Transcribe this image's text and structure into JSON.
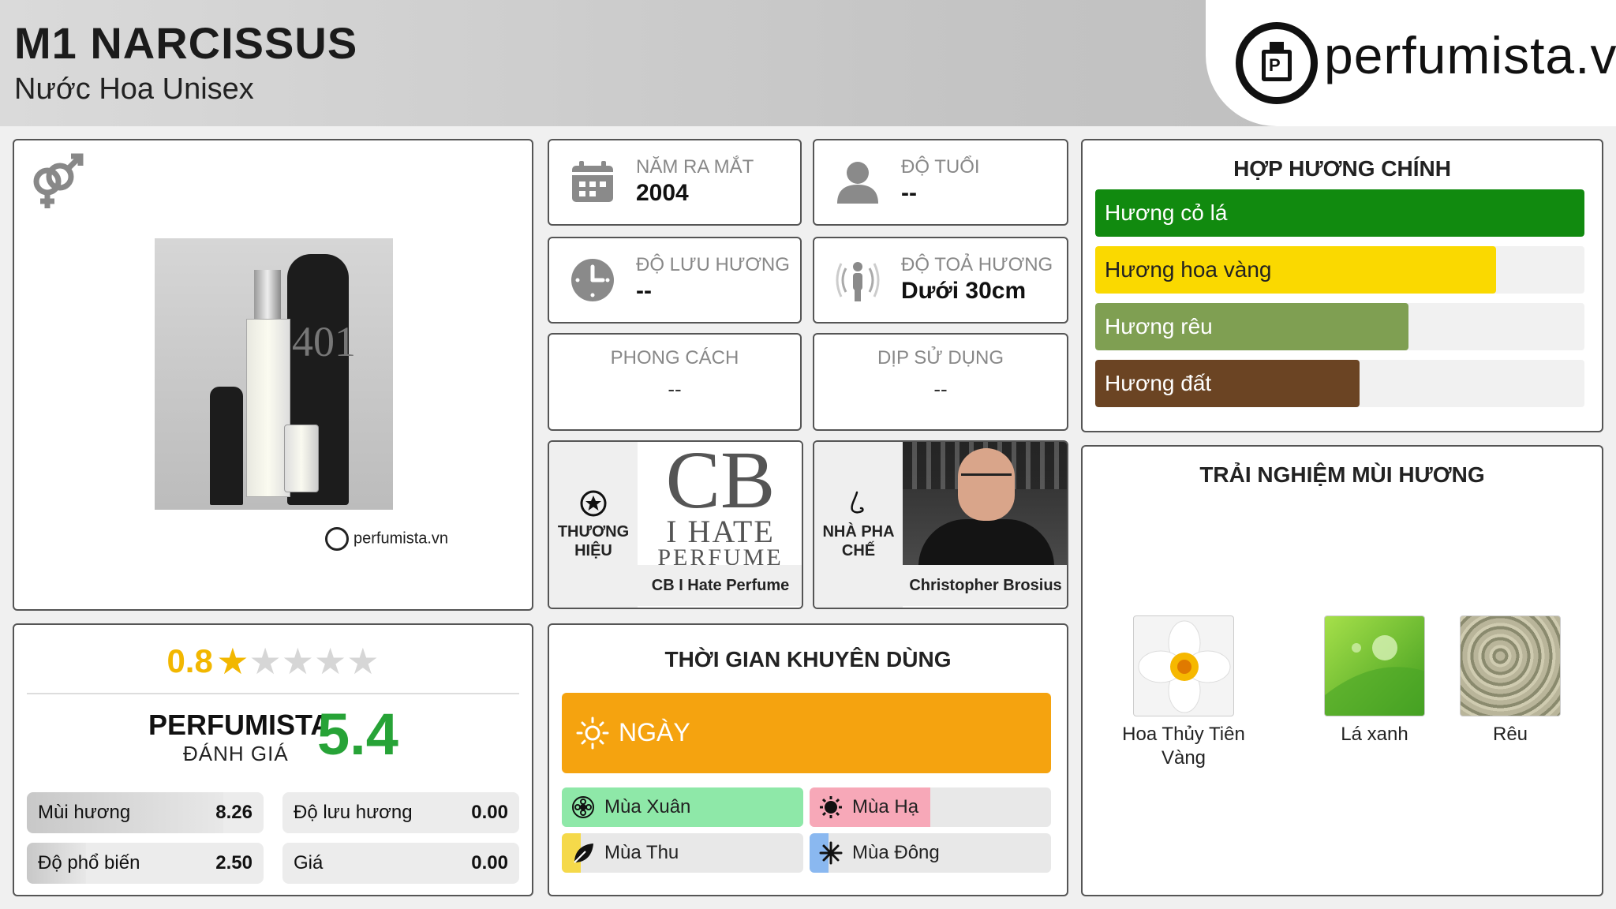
{
  "header": {
    "title": "M1 NARCISSUS",
    "subtitle": "Nước Hoa Unisex",
    "logo_text": "perfumista.vn"
  },
  "product": {
    "watermark": "perfumista.vn",
    "gender_icon": "unisex-icon"
  },
  "info": {
    "release_year": {
      "label": "NĂM RA MẮT",
      "value": "2004",
      "icon": "calendar-icon"
    },
    "age": {
      "label": "ĐỘ TUỔI",
      "value": "--",
      "icon": "person-icon"
    },
    "longevity": {
      "label": "ĐỘ LƯU HƯƠNG",
      "value": "--",
      "icon": "clock-icon"
    },
    "sillage": {
      "label": "ĐỘ TOẢ HƯƠNG",
      "value": "Dưới 30cm",
      "icon": "radiate-icon"
    },
    "style": {
      "label": "PHONG CÁCH",
      "value": "--"
    },
    "occasion": {
      "label": "DỊP SỬ DỤNG",
      "value": "--"
    }
  },
  "brand": {
    "label": "THƯƠNG HIỆU",
    "name": "CB I Hate Perfume",
    "logo_lines": [
      "CB",
      "I HATE",
      "PERFUME"
    ],
    "icon": "star-circle-icon"
  },
  "perfumer": {
    "label": "NHÀ PHA CHẾ",
    "name": "Christopher Brosius",
    "icon": "nose-icon"
  },
  "rating": {
    "score": "0.8",
    "stars_filled": 1,
    "stars_total": 5,
    "perfumista_label": "PERFUMISTA",
    "perfumista_sub": "ĐÁNH GIÁ",
    "perfumista_score": "5.4",
    "metrics": [
      {
        "name": "Mùi hương",
        "value": "8.26",
        "fraction": 0.83
      },
      {
        "name": "Độ lưu hương",
        "value": "0.00",
        "fraction": 0.0
      },
      {
        "name": "Độ phổ biến",
        "value": "2.50",
        "fraction": 0.25
      },
      {
        "name": "Giá",
        "value": "0.00",
        "fraction": 0.0
      }
    ]
  },
  "recommended": {
    "title": "THỜI GIAN KHUYÊN DÙNG",
    "day_label": "NGÀY",
    "day_fraction": 1.0,
    "seasons": [
      {
        "name": "Mùa Xuân",
        "fraction": 1.0,
        "color": "#8ee8a8",
        "icon": "flower-icon"
      },
      {
        "name": "Mùa Hạ",
        "fraction": 0.5,
        "color": "#f7a8b8",
        "icon": "sun-icon"
      },
      {
        "name": "Mùa Thu",
        "fraction": 0.08,
        "color": "#f5d94a",
        "icon": "leaf-icon"
      },
      {
        "name": "Mùa Đông",
        "fraction": 0.08,
        "color": "#8ab8f0",
        "icon": "snowflake-icon"
      }
    ]
  },
  "accords": {
    "title": "HỢP HƯƠNG CHÍNH",
    "items": [
      {
        "name": "Hương cỏ lá",
        "fraction": 1.0,
        "color": "#118a0f"
      },
      {
        "name": "Hương hoa vàng",
        "fraction": 0.82,
        "color": "#fad900"
      },
      {
        "name": "Hương rêu",
        "fraction": 0.64,
        "color": "#7f9f52"
      },
      {
        "name": "Hương đất",
        "fraction": 0.54,
        "color": "#6b4423"
      }
    ]
  },
  "notes": {
    "title": "TRẢI NGHIỆM MÙI HƯƠNG",
    "items": [
      {
        "name": "Hoa Thủy Tiên Vàng",
        "icon": "narcissus-flower-image"
      },
      {
        "name": "Lá xanh",
        "icon": "green-leaf-image"
      },
      {
        "name": "Rêu",
        "icon": "moss-image"
      }
    ]
  }
}
